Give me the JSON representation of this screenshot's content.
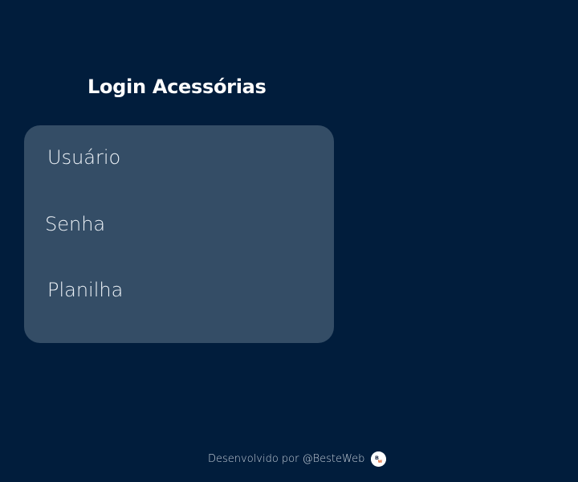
{
  "login": {
    "title": "Login Acessórias",
    "fields": {
      "usuario_placeholder": "Usuário",
      "senha_placeholder": "Senha",
      "planilha_placeholder": "Planilha"
    }
  },
  "footer": {
    "text": "Desenvolvido por @BesteWeb",
    "logo_icon": "besteweb-logo-icon"
  },
  "colors": {
    "background": "#011d3c",
    "card": "#344d66",
    "text": "#ffffff"
  }
}
